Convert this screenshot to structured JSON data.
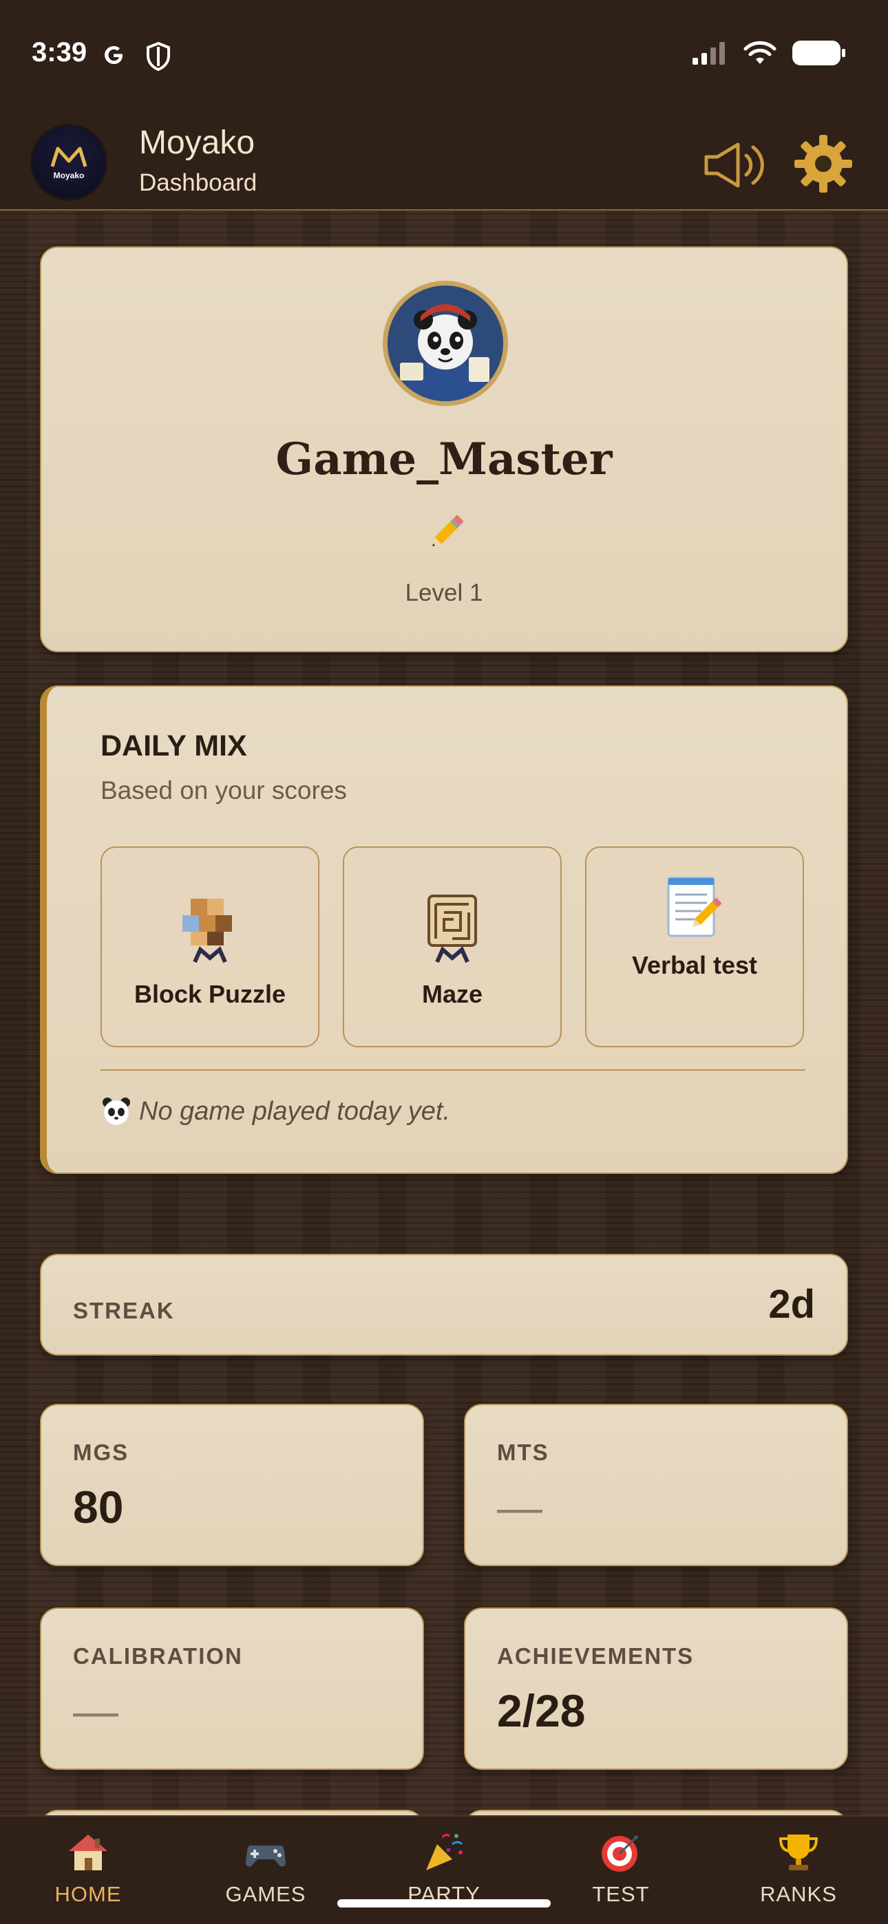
{
  "status_bar": {
    "time": "3:39",
    "icons": [
      "google-icon",
      "shield-icon",
      "signal-icon",
      "wifi-icon",
      "battery-icon"
    ]
  },
  "app_bar": {
    "logo_text": "Moyako",
    "title": "Moyako",
    "subtitle": "Dashboard",
    "icons": [
      "speaker-icon",
      "gear-icon"
    ]
  },
  "profile": {
    "username": "Game_Master",
    "edit_icon": "pencil-icon",
    "level": "Level 1"
  },
  "daily_mix": {
    "title": "DAILY MIX",
    "subtitle": "Based on your scores",
    "games": [
      {
        "label": "Block Puzzle",
        "icon": "block-puzzle-icon"
      },
      {
        "label": "Maze",
        "icon": "maze-icon"
      },
      {
        "label": "Verbal test",
        "icon": "memo-icon"
      }
    ],
    "status": "No game played today yet.",
    "status_icon": "panda-icon"
  },
  "streak": {
    "label": "STREAK",
    "value": "2d"
  },
  "stats": {
    "mgs": {
      "label": "MGS",
      "value": "80"
    },
    "mts": {
      "label": "MTS",
      "value": "—"
    },
    "calibration": {
      "label": "CALIBRATION",
      "value": "—"
    },
    "achievements": {
      "label": "ACHIEVEMENTS",
      "value": "2/28"
    }
  },
  "bottom_nav": {
    "items": [
      {
        "label": "HOME",
        "icon": "house-icon",
        "active": true
      },
      {
        "label": "GAMES",
        "icon": "gamepad-icon"
      },
      {
        "label": "PARTY",
        "icon": "party-popper-icon"
      },
      {
        "label": "TEST",
        "icon": "target-icon"
      },
      {
        "label": "RANKS",
        "icon": "trophy-icon"
      }
    ]
  },
  "colors": {
    "background": "#35261c",
    "card": "#e5d7bd",
    "card_border": "#b89458",
    "accent": "#e9b260",
    "text_dark": "#2a1d14"
  }
}
